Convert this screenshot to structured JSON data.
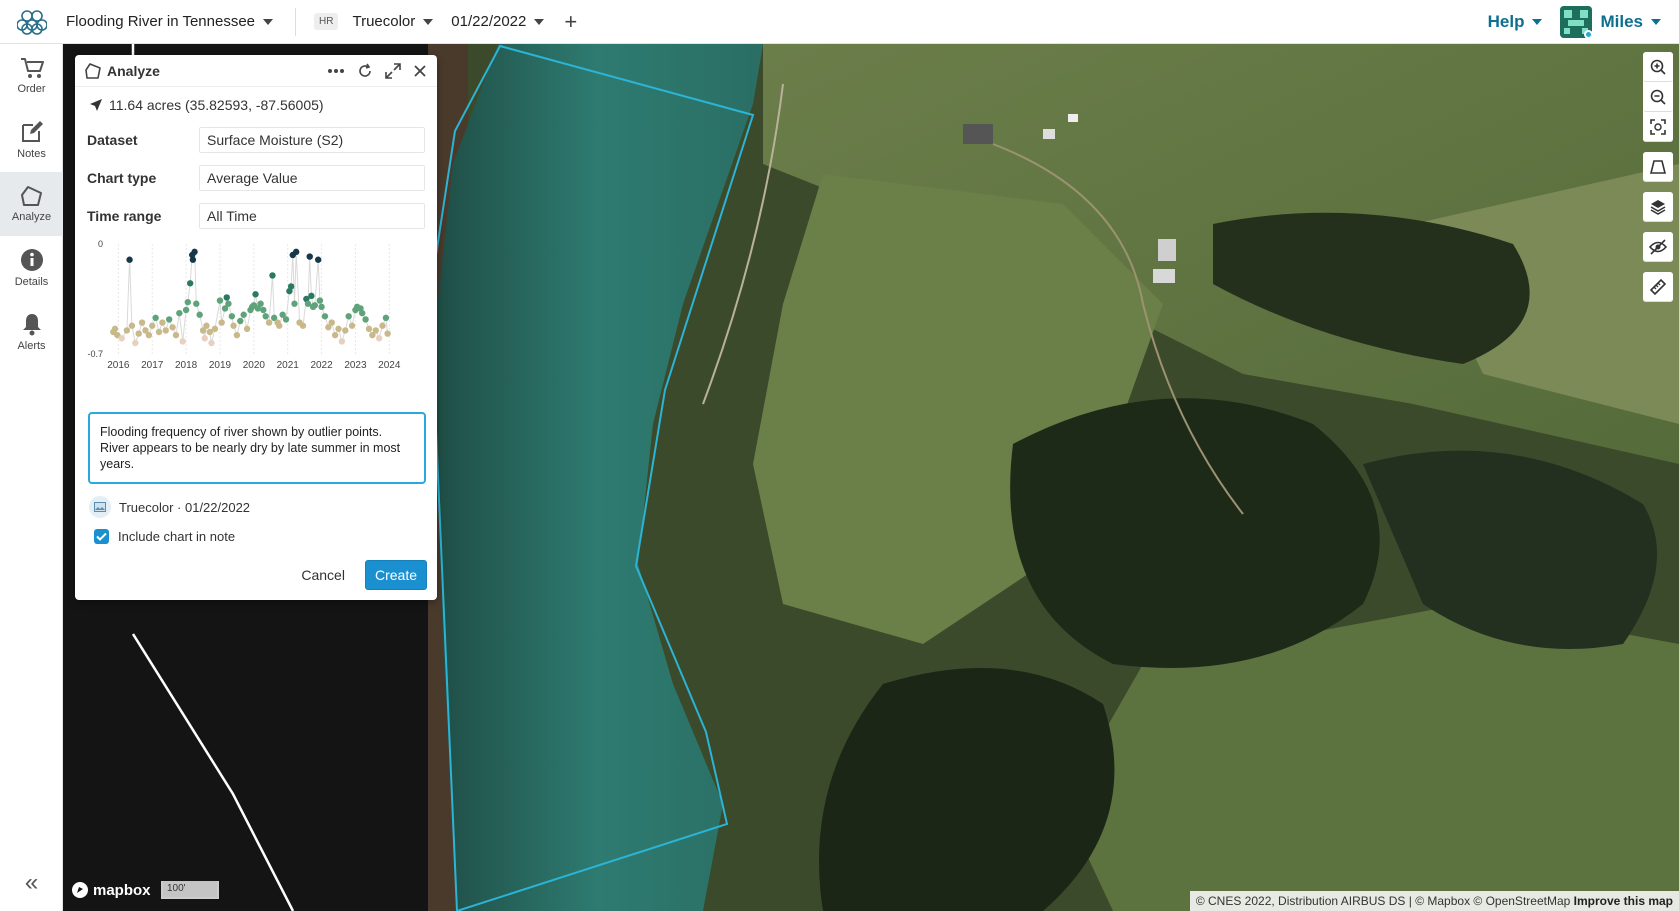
{
  "topbar": {
    "project_name": "Flooding River in Tennessee",
    "layer_badge": "HR",
    "layer_name": "Truecolor",
    "date": "01/22/2022",
    "add_label": "+",
    "help_label": "Help",
    "user_name": "Miles"
  },
  "leftnav": {
    "items": [
      {
        "label": "Order",
        "icon": "cart-icon"
      },
      {
        "label": "Notes",
        "icon": "note-edit-icon"
      },
      {
        "label": "Analyze",
        "icon": "pentagon-icon"
      },
      {
        "label": "Details",
        "icon": "info-icon"
      },
      {
        "label": "Alerts",
        "icon": "bell-icon"
      }
    ],
    "collapse_label": "«"
  },
  "panel": {
    "title": "Analyze",
    "area": "11.64 acres (35.82593, -87.56005)",
    "fields": [
      {
        "label": "Dataset",
        "value": "Surface Moisture (S2)"
      },
      {
        "label": "Chart type",
        "value": "Average Value"
      },
      {
        "label": "Time range",
        "value": "All Time"
      }
    ],
    "note_text": "Flooding frequency of river shown by outlier points. River appears to be nearly dry by late summer in most years.",
    "snapshot_label": "Truecolor · 01/22/2022",
    "include_chart_label": "Include chart in note",
    "cancel_label": "Cancel",
    "create_label": "Create"
  },
  "map": {
    "attribution": "© CNES 2022, Distribution AIRBUS DS | © Mapbox © OpenStreetMap",
    "improve_label": "Improve this map",
    "mapbox_label": "mapbox",
    "scale_label": "100'",
    "polygon_color": "#2bb4d6"
  },
  "chart_data": {
    "type": "scatter",
    "title": "",
    "xlabel": "",
    "ylabel": "",
    "x_ticks": [
      "2016",
      "2017",
      "2018",
      "2019",
      "2020",
      "2021",
      "2022",
      "2023",
      "2024"
    ],
    "y_ticks": [
      "0",
      "-0.7"
    ],
    "ylim": [
      -0.7,
      0
    ],
    "xlim": [
      2015.9,
      2024.05
    ],
    "color_scale": [
      "#e8d0c0",
      "#c9b98a",
      "#5fa37a",
      "#2a7a62",
      "#173848"
    ],
    "points": [
      {
        "x": 2015.85,
        "y": -0.56
      },
      {
        "x": 2015.9,
        "y": -0.54
      },
      {
        "x": 2015.97,
        "y": -0.58
      },
      {
        "x": 2016.1,
        "y": -0.6
      },
      {
        "x": 2016.25,
        "y": -0.55
      },
      {
        "x": 2016.33,
        "y": -0.1
      },
      {
        "x": 2016.4,
        "y": -0.52
      },
      {
        "x": 2016.5,
        "y": -0.63
      },
      {
        "x": 2016.6,
        "y": -0.57
      },
      {
        "x": 2016.7,
        "y": -0.5
      },
      {
        "x": 2016.8,
        "y": -0.55
      },
      {
        "x": 2016.9,
        "y": -0.58
      },
      {
        "x": 2017.0,
        "y": -0.52
      },
      {
        "x": 2017.1,
        "y": -0.47
      },
      {
        "x": 2017.2,
        "y": -0.56
      },
      {
        "x": 2017.3,
        "y": -0.5
      },
      {
        "x": 2017.4,
        "y": -0.55
      },
      {
        "x": 2017.5,
        "y": -0.48
      },
      {
        "x": 2017.6,
        "y": -0.53
      },
      {
        "x": 2017.7,
        "y": -0.58
      },
      {
        "x": 2017.8,
        "y": -0.44
      },
      {
        "x": 2017.9,
        "y": -0.62
      },
      {
        "x": 2018.0,
        "y": -0.42
      },
      {
        "x": 2018.05,
        "y": -0.37
      },
      {
        "x": 2018.12,
        "y": -0.25
      },
      {
        "x": 2018.18,
        "y": -0.07
      },
      {
        "x": 2018.2,
        "y": -0.1
      },
      {
        "x": 2018.25,
        "y": -0.05
      },
      {
        "x": 2018.3,
        "y": -0.38
      },
      {
        "x": 2018.4,
        "y": -0.45
      },
      {
        "x": 2018.5,
        "y": -0.55
      },
      {
        "x": 2018.55,
        "y": -0.6
      },
      {
        "x": 2018.6,
        "y": -0.52
      },
      {
        "x": 2018.7,
        "y": -0.56
      },
      {
        "x": 2018.75,
        "y": -0.63
      },
      {
        "x": 2018.85,
        "y": -0.54
      },
      {
        "x": 2019.0,
        "y": -0.36
      },
      {
        "x": 2019.05,
        "y": -0.5
      },
      {
        "x": 2019.15,
        "y": -0.41
      },
      {
        "x": 2019.2,
        "y": -0.34
      },
      {
        "x": 2019.25,
        "y": -0.38
      },
      {
        "x": 2019.35,
        "y": -0.46
      },
      {
        "x": 2019.4,
        "y": -0.52
      },
      {
        "x": 2019.5,
        "y": -0.58
      },
      {
        "x": 2019.6,
        "y": -0.49
      },
      {
        "x": 2019.7,
        "y": -0.45
      },
      {
        "x": 2019.8,
        "y": -0.54
      },
      {
        "x": 2019.9,
        "y": -0.42
      },
      {
        "x": 2019.95,
        "y": -0.4
      },
      {
        "x": 2020.0,
        "y": -0.39
      },
      {
        "x": 2020.05,
        "y": -0.32
      },
      {
        "x": 2020.12,
        "y": -0.41
      },
      {
        "x": 2020.2,
        "y": -0.38
      },
      {
        "x": 2020.28,
        "y": -0.42
      },
      {
        "x": 2020.35,
        "y": -0.46
      },
      {
        "x": 2020.45,
        "y": -0.5
      },
      {
        "x": 2020.55,
        "y": -0.2
      },
      {
        "x": 2020.6,
        "y": -0.47
      },
      {
        "x": 2020.7,
        "y": -0.5
      },
      {
        "x": 2020.75,
        "y": -0.52
      },
      {
        "x": 2020.85,
        "y": -0.45
      },
      {
        "x": 2020.95,
        "y": -0.48
      },
      {
        "x": 2021.05,
        "y": -0.3
      },
      {
        "x": 2021.1,
        "y": -0.27
      },
      {
        "x": 2021.15,
        "y": -0.07
      },
      {
        "x": 2021.2,
        "y": -0.38
      },
      {
        "x": 2021.25,
        "y": -0.05
      },
      {
        "x": 2021.35,
        "y": -0.5
      },
      {
        "x": 2021.45,
        "y": -0.52
      },
      {
        "x": 2021.55,
        "y": -0.35
      },
      {
        "x": 2021.6,
        "y": -0.38
      },
      {
        "x": 2021.65,
        "y": -0.08
      },
      {
        "x": 2021.7,
        "y": -0.33
      },
      {
        "x": 2021.75,
        "y": -0.4
      },
      {
        "x": 2021.8,
        "y": -0.39
      },
      {
        "x": 2021.9,
        "y": -0.1
      },
      {
        "x": 2021.95,
        "y": -0.36
      },
      {
        "x": 2022.0,
        "y": -0.4
      },
      {
        "x": 2022.1,
        "y": -0.46
      },
      {
        "x": 2022.2,
        "y": -0.53
      },
      {
        "x": 2022.3,
        "y": -0.5
      },
      {
        "x": 2022.4,
        "y": -0.58
      },
      {
        "x": 2022.5,
        "y": -0.54
      },
      {
        "x": 2022.6,
        "y": -0.62
      },
      {
        "x": 2022.7,
        "y": -0.55
      },
      {
        "x": 2022.8,
        "y": -0.46
      },
      {
        "x": 2022.9,
        "y": -0.52
      },
      {
        "x": 2023.0,
        "y": -0.42
      },
      {
        "x": 2023.05,
        "y": -0.4
      },
      {
        "x": 2023.15,
        "y": -0.41
      },
      {
        "x": 2023.2,
        "y": -0.44
      },
      {
        "x": 2023.3,
        "y": -0.48
      },
      {
        "x": 2023.4,
        "y": -0.54
      },
      {
        "x": 2023.5,
        "y": -0.58
      },
      {
        "x": 2023.6,
        "y": -0.55
      },
      {
        "x": 2023.7,
        "y": -0.6
      },
      {
        "x": 2023.8,
        "y": -0.52
      },
      {
        "x": 2023.9,
        "y": -0.47
      },
      {
        "x": 2023.95,
        "y": -0.57
      }
    ]
  }
}
